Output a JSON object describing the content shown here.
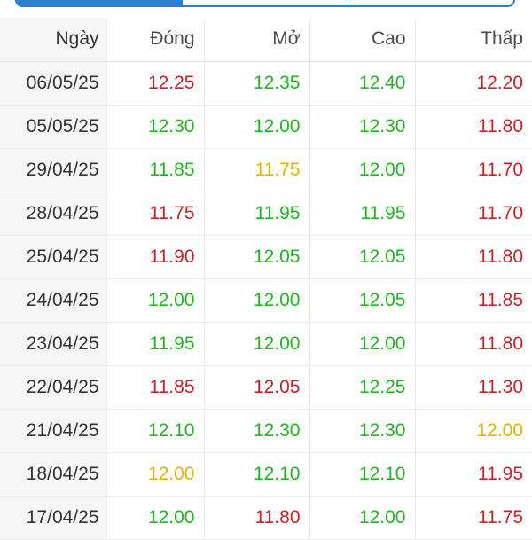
{
  "tabs": [
    {
      "label": "",
      "active": true
    },
    {
      "label": "",
      "active": false
    },
    {
      "label": "",
      "active": false
    }
  ],
  "table": {
    "headers": {
      "date": "Ngày",
      "close": "Đóng",
      "open": "Mở",
      "high": "Cao",
      "low": "Thấp"
    },
    "rows": [
      {
        "date": "06/05/25",
        "close": "12.25",
        "open": "12.35",
        "high": "12.40",
        "low": "12.20"
      },
      {
        "date": "05/05/25",
        "close": "12.30",
        "open": "12.00",
        "high": "12.30",
        "low": "11.80"
      },
      {
        "date": "29/04/25",
        "close": "11.85",
        "open": "11.75",
        "high": "12.00",
        "low": "11.70"
      },
      {
        "date": "28/04/25",
        "close": "11.75",
        "open": "11.95",
        "high": "11.95",
        "low": "11.70"
      },
      {
        "date": "25/04/25",
        "close": "11.90",
        "open": "12.05",
        "high": "12.05",
        "low": "11.80"
      },
      {
        "date": "24/04/25",
        "close": "12.00",
        "open": "12.00",
        "high": "12.05",
        "low": "11.85"
      },
      {
        "date": "23/04/25",
        "close": "11.95",
        "open": "12.00",
        "high": "12.00",
        "low": "11.80"
      },
      {
        "date": "22/04/25",
        "close": "11.85",
        "open": "12.05",
        "high": "12.25",
        "low": "11.30"
      },
      {
        "date": "21/04/25",
        "close": "12.10",
        "open": "12.30",
        "high": "12.30",
        "low": "12.00"
      },
      {
        "date": "18/04/25",
        "close": "12.00",
        "open": "12.10",
        "high": "12.10",
        "low": "11.95"
      },
      {
        "date": "17/04/25",
        "close": "12.00",
        "open": "11.80",
        "high": "12.00",
        "low": "11.75"
      }
    ]
  },
  "colors": {
    "up": "#22b522",
    "down": "#c4242a",
    "reference": "#e0b400",
    "tab_accent": "#2d7fd0"
  }
}
